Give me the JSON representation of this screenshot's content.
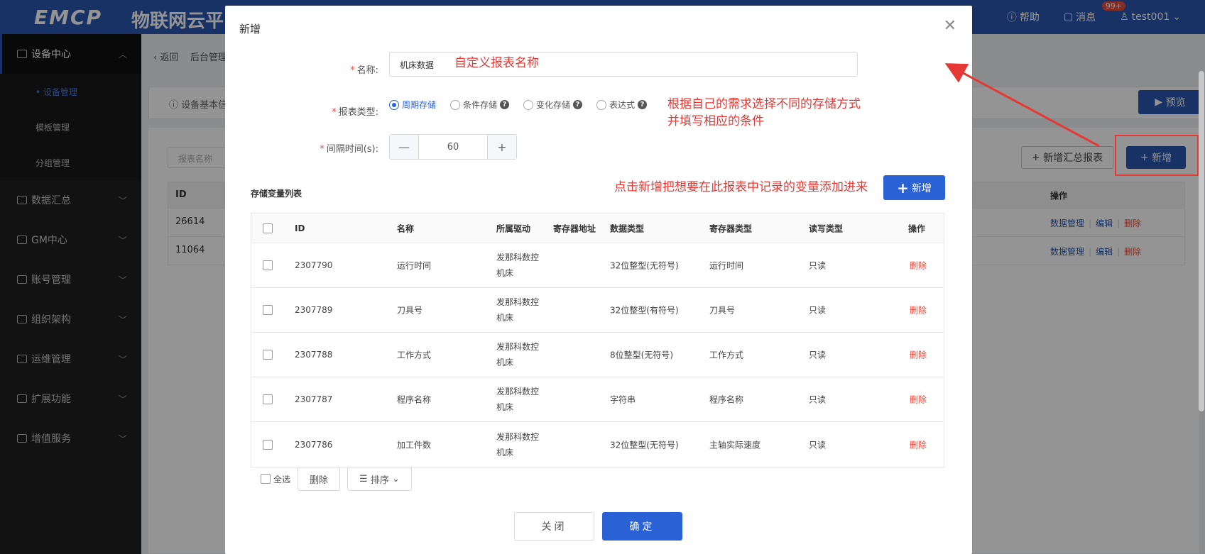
{
  "app": {
    "logo": "EMCP",
    "logo_cn": "物联网云平台",
    "help": "帮助",
    "messages": "消息",
    "badge": "99+",
    "user": "test001"
  },
  "sidebar": {
    "groups": [
      {
        "label": "设备中心"
      },
      {
        "label": "数据汇总"
      },
      {
        "label": "GM中心"
      },
      {
        "label": "账号管理"
      },
      {
        "label": "组织架构"
      },
      {
        "label": "运维管理"
      },
      {
        "label": "扩展功能"
      },
      {
        "label": "增值服务"
      }
    ],
    "subs": [
      {
        "label": "• 设备管理"
      },
      {
        "label": "模板管理"
      },
      {
        "label": "分组管理"
      }
    ]
  },
  "bg": {
    "back": "返回",
    "crumb": "后台管理",
    "tab": "设备基本信",
    "preview": "预览",
    "search_placeholder": "报表名称",
    "summary_btn": "新增汇总报表",
    "add_btn": "新增",
    "col_id": "ID",
    "col_ops": "操作",
    "rows": [
      {
        "id": "26614",
        "op1": "数据管理",
        "op2": "编辑",
        "op3": "删除"
      },
      {
        "id": "11064",
        "op1": "数据管理",
        "op2": "编辑",
        "op3": "删除"
      }
    ]
  },
  "modal": {
    "title": "新增",
    "name_label": "名称:",
    "name_value": "机床数据",
    "type_label": "报表类型:",
    "types": [
      {
        "label": "周期存储",
        "checked": true
      },
      {
        "label": "条件存储",
        "help": true
      },
      {
        "label": "变化存储",
        "help": true
      },
      {
        "label": "表达式",
        "help": true
      }
    ],
    "interval_label": "间隔时间(s):",
    "interval_value": "60",
    "list_title": "存储变量列表",
    "add_var": "新增",
    "columns": {
      "id": "ID",
      "name": "名称",
      "driver": "所属驱动",
      "addr": "寄存器地址",
      "dtype": "数据类型",
      "rtype": "寄存器类型",
      "rw": "读写类型",
      "op": "操作"
    },
    "rows": [
      {
        "id": "2307790",
        "name": "运行时间",
        "driver1": "发那科数控",
        "driver2": "机床",
        "dtype": "32位整型(无符号)",
        "rtype": "运行时间",
        "rw": "只读",
        "op": "删除"
      },
      {
        "id": "2307789",
        "name": "刀具号",
        "driver1": "发那科数控",
        "driver2": "机床",
        "dtype": "32位整型(有符号)",
        "rtype": "刀具号",
        "rw": "只读",
        "op": "删除"
      },
      {
        "id": "2307788",
        "name": "工作方式",
        "driver1": "发那科数控",
        "driver2": "机床",
        "dtype": "8位整型(无符号)",
        "rtype": "工作方式",
        "rw": "只读",
        "op": "删除"
      },
      {
        "id": "2307787",
        "name": "程序名称",
        "driver1": "发那科数控",
        "driver2": "机床",
        "dtype": "字符串",
        "rtype": "程序名称",
        "rw": "只读",
        "op": "删除"
      },
      {
        "id": "2307786",
        "name": "加工件数",
        "driver1": "发那科数控",
        "driver2": "机床",
        "dtype": "32位整型(无符号)",
        "rtype": "主轴实际速度",
        "rw": "只读",
        "op": "删除"
      }
    ],
    "select_all": "全选",
    "delete": "删除",
    "sort": "排序",
    "close": "关闭",
    "ok": "确定"
  },
  "annotations": {
    "name_hint": "自定义报表名称",
    "type_hint_1": "根据自己的需求选择不同的存储方式",
    "type_hint_2": "并填写相应的条件",
    "add_hint": "点击新增把想要在此报表中记录的变量添加进来"
  },
  "colors": {
    "primary": "#2a56b0",
    "accent": "#2a62d6",
    "annotation": "#e53935",
    "danger": "#e74c3c"
  }
}
